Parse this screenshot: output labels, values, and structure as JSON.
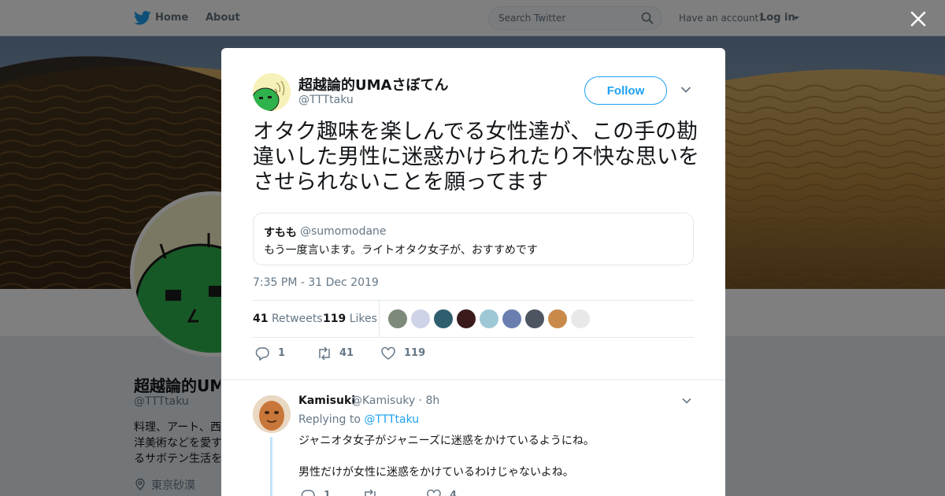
{
  "nav": {
    "home": "Home",
    "about": "About",
    "search_placeholder": "Search Twitter",
    "have_account": "Have an account?",
    "login": "Log in"
  },
  "profile": {
    "name": "超越論的UMAさぼてん",
    "handle": "@TTTtaku",
    "bio": "料理、アート、西洋美術などを愛するサボテン生活を謳歌中。",
    "location": "東京砂漠"
  },
  "tweet": {
    "author_name": "超越論的UMAさぼてん",
    "author_handle": "@TTTtaku",
    "follow_label": "Follow",
    "text": "オタク趣味を楽しんでる女性達が、この手の勘違いした男性に迷惑かけられたり不快な思いをさせられないことを願ってます",
    "quote": {
      "name": "すもも",
      "handle": "@sumomodane",
      "text": "もう一度言います。ライトオタク女子が、おすすめです"
    },
    "timestamp": "7:35 PM - 31 Dec 2019",
    "retweets_count": "41",
    "retweets_label": "Retweets",
    "likes_count": "119",
    "likes_label": "Likes",
    "likers": [
      "#7d8a7a",
      "#cfd3e8",
      "#2f5f6e",
      "#3a1a1a",
      "#9fc8d6",
      "#6a7fb0",
      "#4d5560",
      "#c9894a",
      "#e8e8e8"
    ],
    "actions": {
      "replies": "1",
      "retweets": "41",
      "likes": "119"
    }
  },
  "reply": {
    "name": "Kamisuki",
    "handle": "@Kamisuky · 8h",
    "replying_prefix": "Replying to",
    "replying_to": "@TTTtaku",
    "line1": "ジャニオタ女子がジャニーズに迷惑をかけているようにね。",
    "line2": "男性だけが女性に迷惑をかけているわけじゃないよね。",
    "actions": {
      "replies": "1",
      "retweets": "",
      "likes": "4"
    }
  },
  "colors": {
    "accent": "#1da1f2",
    "muted": "#657786",
    "text": "#14171a"
  }
}
